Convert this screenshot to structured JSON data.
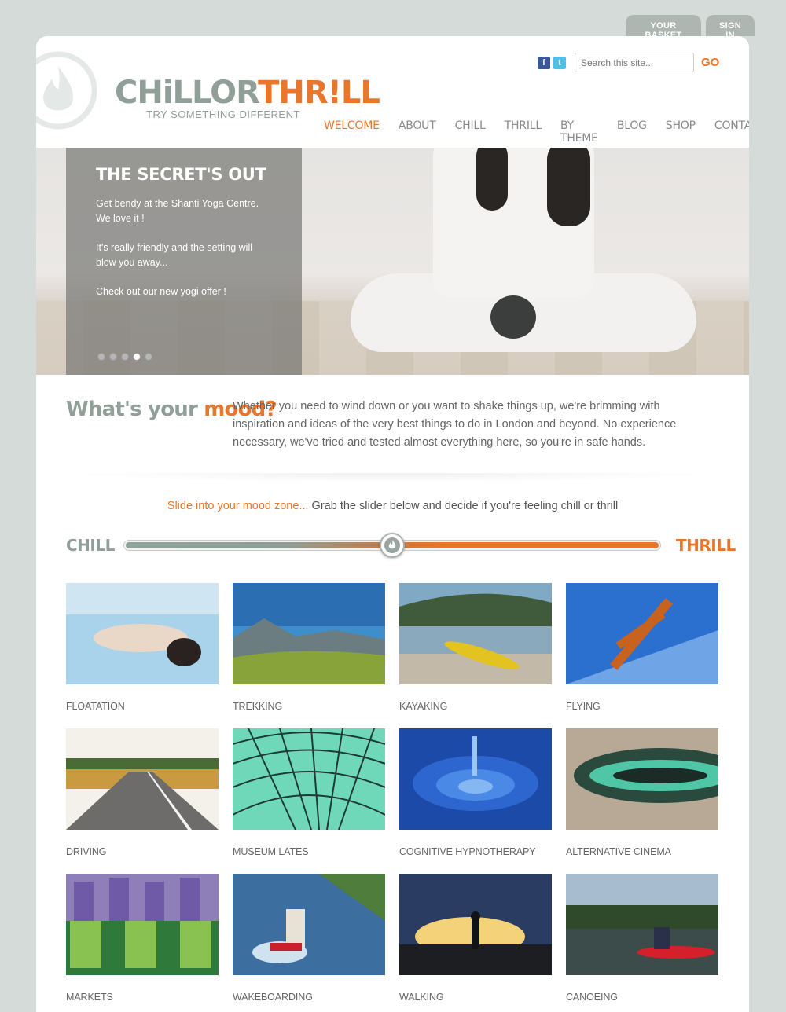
{
  "top_tabs": {
    "basket": "YOUR BASKET",
    "signin": "SIGN IN"
  },
  "logo": {
    "chill": "CHiLLOR",
    "thrill": "THR!LL",
    "tagline": "TRY SOMETHING DIFFERENT"
  },
  "search": {
    "placeholder": "Search this site...",
    "go": "GO"
  },
  "social": {
    "facebook": "f",
    "twitter": "t"
  },
  "nav": [
    {
      "label": "WELCOME"
    },
    {
      "label": "ABOUT"
    },
    {
      "label": "CHILL"
    },
    {
      "label": "THRILL"
    },
    {
      "label": "BY THEME"
    },
    {
      "label": "BLOG"
    },
    {
      "label": "SHOP"
    },
    {
      "label": "CONTACT"
    }
  ],
  "hero": {
    "title": "THE SECRET'S OUT",
    "p1": "Get bendy at the Shanti Yoga Centre. We love it !",
    "p2": "It's really friendly and the setting will blow you away...",
    "p3": "Check out our new yogi offer !"
  },
  "mood": {
    "title_prefix": "What's your ",
    "title_word": "mood?",
    "text": "Whether you need to wind down or you want to shake things up, we're brimming with inspiration and ideas of the very best things to do in London and beyond. No experience necessary, we've tried and tested almost everything here, so you're in safe hands."
  },
  "slider": {
    "intro_accent": "Slide into your mood zone...",
    "intro_rest": " Grab the slider below and decide if you're feeling chill or thrill",
    "left_label": "CHILL",
    "right_label": "THRILL",
    "position": 0.5
  },
  "tiles": [
    {
      "label": "FLOATATION"
    },
    {
      "label": "TREKKING"
    },
    {
      "label": "KAYAKING"
    },
    {
      "label": "FLYING"
    },
    {
      "label": "DRIVING"
    },
    {
      "label": "MUSEUM LATES"
    },
    {
      "label": "COGNITIVE HYPNOTHERAPY"
    },
    {
      "label": "ALTERNATIVE CINEMA"
    },
    {
      "label": "MARKETS"
    },
    {
      "label": "WAKEBOARDING"
    },
    {
      "label": "WALKING"
    },
    {
      "label": "CANOEING"
    }
  ],
  "colors": {
    "accent": "#e8762c",
    "chill": "#90a099"
  }
}
